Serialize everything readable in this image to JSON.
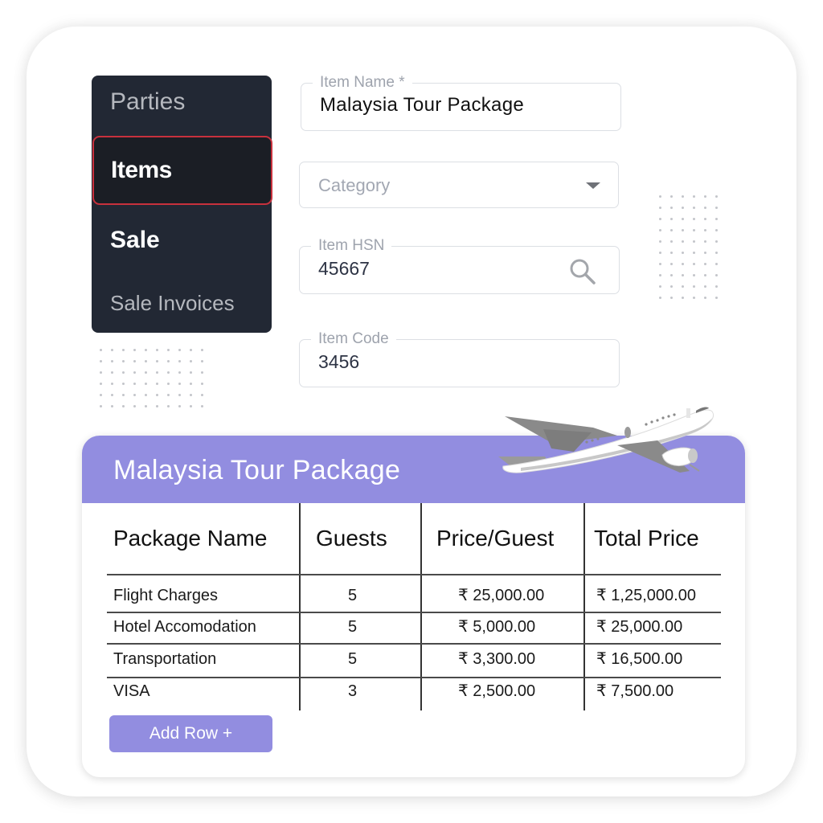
{
  "sidebar": {
    "items": [
      {
        "label": "Parties",
        "active": false
      },
      {
        "label": "Items",
        "active": true
      },
      {
        "label": "Sale",
        "active": false
      },
      {
        "label": "Sale Invoices",
        "active": false
      }
    ]
  },
  "form": {
    "item_name": {
      "label": "Item Name *",
      "value": "Malaysia Tour Package"
    },
    "category": {
      "placeholder": "Category",
      "icon": "chevron-down-icon"
    },
    "item_hsn": {
      "label": "Item HSN",
      "value": "45667",
      "icon": "search-icon"
    },
    "item_code": {
      "label": "Item Code",
      "value": "3456"
    }
  },
  "package_card": {
    "title": "Malaysia Tour Package",
    "illustration": "airplane-icon",
    "columns": [
      "Package Name",
      "Guests",
      "Price/Guest",
      "Total Price"
    ],
    "rows": [
      {
        "name": "Flight Charges",
        "guests": "5",
        "price_per_guest": "₹ 25,000.00",
        "total": "₹ 1,25,000.00"
      },
      {
        "name": "Hotel Accomodation",
        "guests": "5",
        "price_per_guest": "₹ 5,000.00",
        "total": "₹ 25,000.00"
      },
      {
        "name": "Transportation",
        "guests": "5",
        "price_per_guest": "₹ 3,300.00",
        "total": "₹ 16,500.00"
      },
      {
        "name": "VISA",
        "guests": "3",
        "price_per_guest": "₹ 2,500.00",
        "total": "₹ 7,500.00"
      }
    ],
    "add_row_label": "Add Row +"
  },
  "colors": {
    "accent": "#928de0",
    "sidebar_bg": "#222834",
    "active_border": "#c8313d"
  }
}
